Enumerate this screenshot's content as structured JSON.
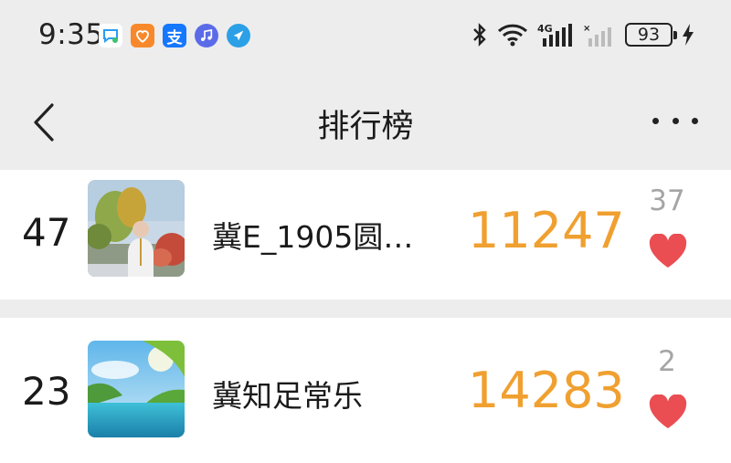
{
  "status_bar": {
    "time": "9:35",
    "battery": "93",
    "app_icons": [
      "chat-bubble-icon",
      "heart-app-icon",
      "alipay-icon",
      "music-icon",
      "compass-icon"
    ],
    "network": "4G"
  },
  "nav": {
    "title": "排行榜",
    "back_icon": "chevron-left-icon",
    "more_icon": "more-dots-icon"
  },
  "rankings": [
    {
      "rank": "47",
      "name": "冀E_1905圆…",
      "steps": "11247",
      "likes": "37"
    },
    {
      "rank": "23",
      "name": "冀知足常乐",
      "steps": "14283",
      "likes": "2"
    }
  ],
  "colors": {
    "steps": "#f0a030",
    "heart": "#ea4e53",
    "background": "#ededed",
    "card": "#ffffff"
  }
}
